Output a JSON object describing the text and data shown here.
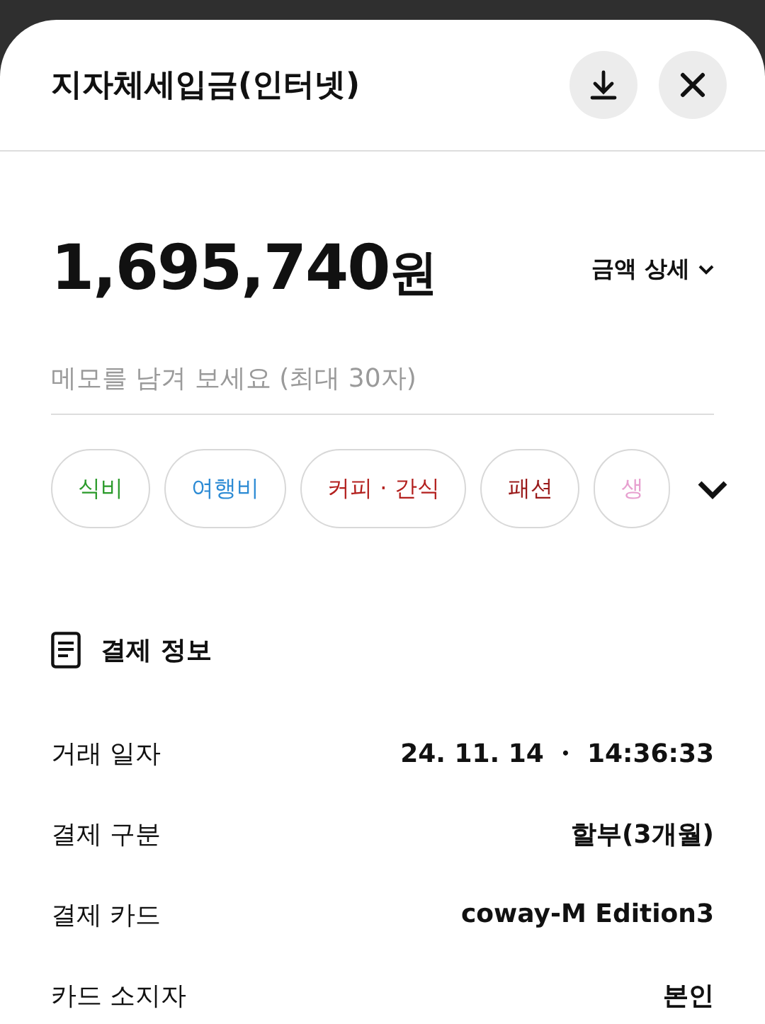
{
  "header": {
    "title": "지자체세입금(인터넷)"
  },
  "amount": {
    "value": "1,695,740",
    "unit": "원",
    "detail_label": "금액 상세"
  },
  "memo": {
    "placeholder": "메모를 남겨 보세요 (최대 30자)"
  },
  "categories": [
    {
      "label": "식비",
      "color": "#2a9a2a"
    },
    {
      "label": "여행비",
      "color": "#2b8ad4"
    },
    {
      "label": "커피 · 간식",
      "color": "#b3201e"
    },
    {
      "label": "패션",
      "color": "#9a1a1a"
    },
    {
      "label": "생",
      "color": "#e79fcf"
    }
  ],
  "payment_info": {
    "title": "결제 정보",
    "rows": [
      {
        "label": "거래 일자",
        "value": "24. 11. 14 ・ 14:36:33"
      },
      {
        "label": "결제 구분",
        "value": "할부(3개월)"
      },
      {
        "label": "결제 카드",
        "value": "coway-M Edition3"
      },
      {
        "label": "카드 소지자",
        "value": "본인"
      }
    ]
  }
}
